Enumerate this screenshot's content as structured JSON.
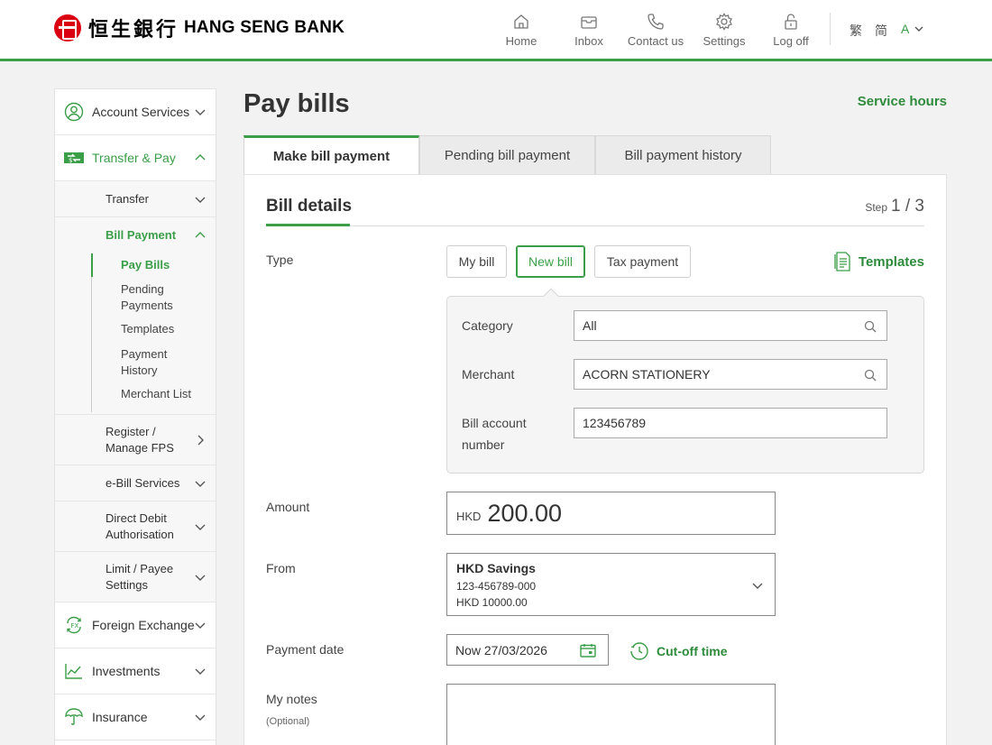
{
  "brand": {
    "chinese_name": "恒生銀行",
    "english_name": "HANG SENG BANK"
  },
  "topnav": [
    {
      "label": "Home",
      "icon": "home-icon"
    },
    {
      "label": "Inbox",
      "icon": "inbox-icon"
    },
    {
      "label": "Contact us",
      "icon": "phone-icon"
    },
    {
      "label": "Settings",
      "icon": "gear-icon"
    },
    {
      "label": "Log off",
      "icon": "lock-icon"
    }
  ],
  "languages": {
    "traditional": "繁",
    "simplified": "简"
  },
  "font_size_label": "A",
  "colors": {
    "accent": "#3b9e48",
    "accent_text": "#2e8b3c",
    "brand_red": "#db0011"
  },
  "sidebar": {
    "account_services": "Account Services",
    "transfer_pay": "Transfer & Pay",
    "transfer": "Transfer",
    "bill_payment": "Bill Payment",
    "bill_items": [
      "Pay Bills",
      "Pending Payments",
      "Templates",
      "Payment History",
      "Merchant List"
    ],
    "register_fps": "Register / Manage FPS",
    "ebill": "e-Bill Services",
    "direct_debit": "Direct Debit Authorisation",
    "limit_payee": "Limit / Payee Settings",
    "foreign_exchange": "Foreign Exchange",
    "investments": "Investments",
    "insurance": "Insurance"
  },
  "page": {
    "title": "Pay bills",
    "service_hours": "Service hours"
  },
  "tabs": [
    "Make bill payment",
    "Pending bill payment",
    "Bill payment history"
  ],
  "form": {
    "section_title": "Bill details",
    "step_label": "Step",
    "step_value": "1 / 3",
    "type_label": "Type",
    "type_options": [
      "My bill",
      "New bill",
      "Tax payment"
    ],
    "type_selected": "New bill",
    "templates_link": "Templates",
    "category_label": "Category",
    "category_value": "All",
    "merchant_label": "Merchant",
    "merchant_value": "ACORN STATIONERY",
    "bill_account_label": "Bill account number",
    "bill_account_value": "123456789",
    "amount_label": "Amount",
    "amount_currency": "HKD",
    "amount_value": "200.00",
    "from_label": "From",
    "from_account_name": "HKD Savings",
    "from_account_number": "123-456789-000",
    "from_account_balance": "HKD 10000.00",
    "payment_date_label": "Payment date",
    "payment_date_value": "Now 27/03/2026",
    "cutoff_link": "Cut-off time",
    "notes_label": "My notes",
    "notes_hint": "(Optional)",
    "notes_value": ""
  }
}
